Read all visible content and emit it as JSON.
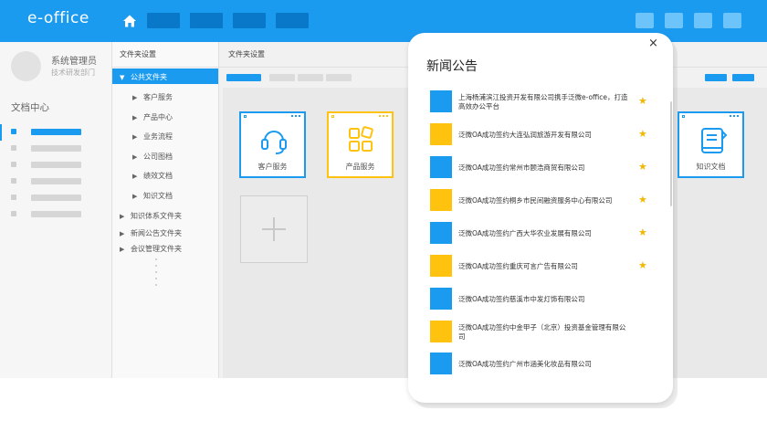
{
  "app": {
    "brand": "e-office"
  },
  "user": {
    "name": "系统管理员",
    "department": "技术研发部门"
  },
  "sidebar": {
    "section_title": "文档中心"
  },
  "tree": {
    "title": "文件夹设置",
    "items": [
      {
        "label": "公共文件夹",
        "arrow": "▼",
        "selected": true,
        "indent": 0
      },
      {
        "label": "客户服务",
        "arrow": "▶",
        "indent": 1
      },
      {
        "label": "产品中心",
        "arrow": "▶",
        "indent": 1
      },
      {
        "label": "业务流程",
        "arrow": "▶",
        "indent": 1
      },
      {
        "label": "公司图档",
        "arrow": "▶",
        "indent": 1
      },
      {
        "label": "绩效文档",
        "arrow": "▶",
        "indent": 1
      },
      {
        "label": "知识文档",
        "arrow": "▶",
        "indent": 1
      },
      {
        "label": "知识体系文件夹",
        "arrow": "▶",
        "indent": 0
      },
      {
        "label": "新闻公告文件夹",
        "arrow": "▶",
        "indent": 0
      },
      {
        "label": "会议管理文件夹",
        "arrow": "▶",
        "indent": 0
      }
    ]
  },
  "main": {
    "title": "文件夹设置",
    "tiles": [
      {
        "label": "客户服务",
        "icon": "headset-icon",
        "color": "#1b9bf0"
      },
      {
        "label": "产品服务",
        "icon": "grid-icon",
        "color": "#ffc20e"
      },
      {
        "label": "知识文档",
        "icon": "book-icon",
        "color": "#1b9bf0"
      }
    ]
  },
  "modal": {
    "title": "新闻公告",
    "close": "×",
    "items": [
      {
        "text": "上海杨浦滨江投资开发有限公司携手泛微e-office，打造高效办公平台",
        "color": "#1b9bf0",
        "starred": true
      },
      {
        "text": "泛微OA成功签约大连弘润旅游开发有限公司",
        "color": "#ffc20e",
        "starred": true
      },
      {
        "text": "泛微OA成功签约常州市颐浩商贸有限公司",
        "color": "#1b9bf0",
        "starred": true
      },
      {
        "text": "泛微OA成功签约桐乡市民间融资服务中心有限公司",
        "color": "#ffc20e",
        "starred": true
      },
      {
        "text": "泛微OA成功签约广西大华农业发展有限公司",
        "color": "#1b9bf0",
        "starred": true
      },
      {
        "text": "泛微OA成功签约重庆可言广告有限公司",
        "color": "#ffc20e",
        "starred": true
      },
      {
        "text": "泛微OA成功签约慈溪市中发灯饰有限公司",
        "color": "#1b9bf0",
        "starred": false
      },
      {
        "text": "泛微OA成功签约中金甲子（北京）投资基金管理有限公司",
        "color": "#ffc20e",
        "starred": false
      },
      {
        "text": "泛微OA成功签约广州市涵美化妆品有限公司",
        "color": "#1b9bf0",
        "starred": false
      }
    ],
    "star_glyph": "★"
  },
  "colors": {
    "primary": "#1b9bf0",
    "accent": "#ffc20e",
    "star": "#f2b705"
  }
}
